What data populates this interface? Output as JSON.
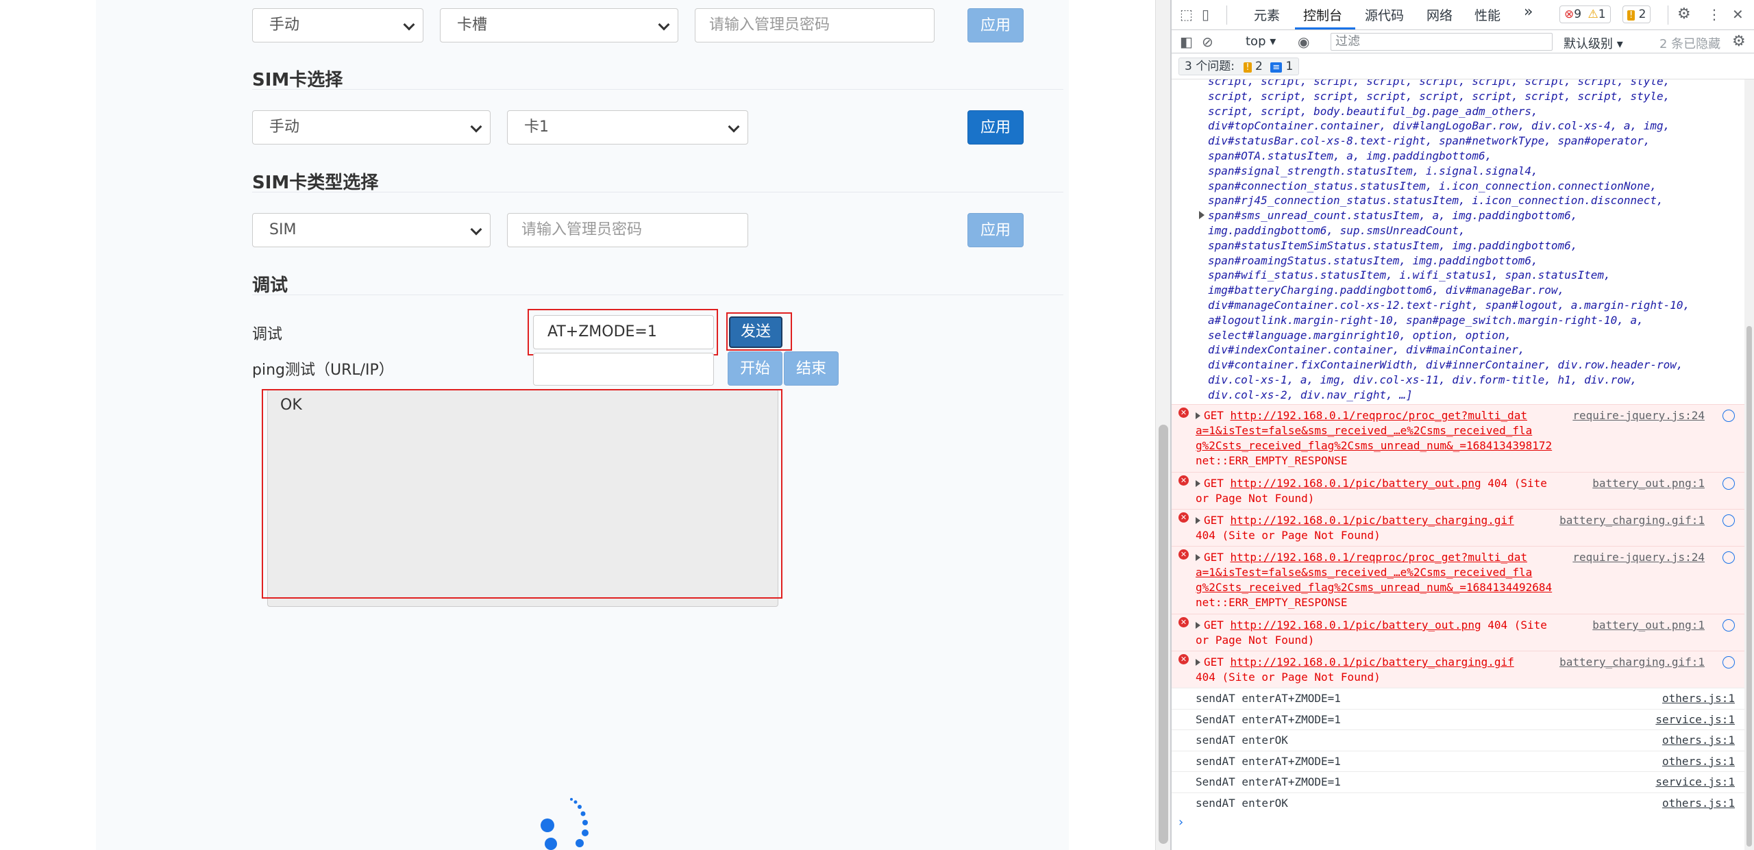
{
  "page": {
    "row0": {
      "mode": "手动",
      "slot": "卡槽",
      "password_placeholder": "请输入管理员密码",
      "apply": "应用"
    },
    "sim_select": {
      "title": "SIM卡选择",
      "mode": "手动",
      "card": "卡1",
      "apply": "应用"
    },
    "sim_type": {
      "title": "SIM卡类型选择",
      "type": "SIM",
      "password_placeholder": "请输入管理员密码",
      "apply": "应用"
    },
    "debug": {
      "title": "调试",
      "at_label": "调试",
      "at_value": "AT+ZMODE=1",
      "send": "发送",
      "ping_label": "ping测试（URL/IP）",
      "start": "开始",
      "stop": "结束",
      "output": "OK"
    }
  },
  "devtools": {
    "tabs": [
      "元素",
      "控制台",
      "源代码",
      "网络",
      "性能"
    ],
    "active_tab": "控制台",
    "more": "»",
    "errors_count": "9",
    "warnings_count": "1",
    "issues_badge": "2",
    "context": "top",
    "filter_placeholder": "过滤",
    "level": "默认级别",
    "hidden": "2 条已隐藏",
    "issues_label": "3 个问题:",
    "issues_warn": "2",
    "issues_info": "1",
    "elements_lines": [
      "script, script, script, script, script, script, script, script, style,",
      "script, script, script, script, script, script, script, script, style,",
      "script, script, body.beautiful_bg.page_adm_others,",
      "div#topContainer.container, div#langLogoBar.row, div.col-xs-4, a, img,",
      "div#statusBar.col-xs-8.text-right, span#networkType, span#operator,",
      "span#OTA.statusItem, a, img.paddingbottom6,",
      "span#signal_strength.statusItem, i.signal.signal4,",
      "span#connection_status.statusItem, i.icon_connection.connectionNone,",
      "span#rj45_connection_status.statusItem, i.icon_connection.disconnect,",
      "span#sms_unread_count.statusItem, a, img.paddingbottom6,",
      "img.paddingbottom6, sup.smsUnreadCount,",
      "span#statusItemSimStatus.statusItem, img.paddingbottom6,",
      "span#roamingStatus.statusItem, img.paddingbottom6,",
      "span#wifi_status.statusItem, i.wifi_status1, span.statusItem,",
      "img#batteryCharging.paddingbottom6, div#manageBar.row,",
      "div#manageContainer.col-xs-12.text-right, span#logout, a.margin-right-10,",
      "a#logoutlink.margin-right-10, span#page_switch.margin-right-10, a,",
      "select#language.marginright10, option, option,",
      "div#indexContainer.container, div#mainContainer,",
      "div#container.fixContainerWidth, div#innerContainer, div.row.header-row,",
      "div.col-xs-1, a, img, div.col-xs-11, div.form-title, h1, div.row,",
      "div.col-xs-2, div.nav_right, …]"
    ],
    "errors": [
      {
        "method": "GET",
        "url": [
          "http://192.168.0.1/reqproc/proc_get?multi_dat",
          "a=1&isTest=false&sms_received_…e%2Csms_received_fla",
          "g%2Csts_received_flag%2Csms_unread_num&_=1684134398172"
        ],
        "tail": "net::ERR_EMPTY_RESPONSE",
        "source": "require-jquery.js:24"
      },
      {
        "method": "GET",
        "url": [
          "http://192.168.0.1/pic/battery_out.png"
        ],
        "status": "404 (Site",
        "tail": "or Page Not Found)",
        "source": "battery_out.png:1"
      },
      {
        "method": "GET",
        "url": [
          "http://192.168.0.1/pic/battery_charging.gif"
        ],
        "tail": "404 (Site or Page Not Found)",
        "source": "battery_charging.gif:1"
      },
      {
        "method": "GET",
        "url": [
          "http://192.168.0.1/reqproc/proc_get?multi_dat",
          "a=1&isTest=false&sms_received_…e%2Csms_received_fla",
          "g%2Csts_received_flag%2Csms_unread_num&_=1684134492684"
        ],
        "tail": "net::ERR_EMPTY_RESPONSE",
        "source": "require-jquery.js:24"
      },
      {
        "method": "GET",
        "url": [
          "http://192.168.0.1/pic/battery_out.png"
        ],
        "status": "404 (Site",
        "tail": "or Page Not Found)",
        "source": "battery_out.png:1"
      },
      {
        "method": "GET",
        "url": [
          "http://192.168.0.1/pic/battery_charging.gif"
        ],
        "tail": "404 (Site or Page Not Found)",
        "source": "battery_charging.gif:1"
      }
    ],
    "logs": [
      {
        "text": "sendAT enterAT+ZMODE=1",
        "source": "others.js:1"
      },
      {
        "text": "SendAT enterAT+ZMODE=1",
        "source": "service.js:1"
      },
      {
        "text": "sendAT enterOK",
        "source": "others.js:1"
      },
      {
        "text": "sendAT enterAT+ZMODE=1",
        "source": "others.js:1"
      },
      {
        "text": "SendAT enterAT+ZMODE=1",
        "source": "service.js:1"
      },
      {
        "text": "sendAT enterOK",
        "source": "others.js:1"
      }
    ],
    "prompt": "›"
  },
  "colors": {
    "accent": "#1a73c9",
    "accent_light": "#84b4e4",
    "highlight": "#e02020",
    "error_bg": "#fff0f0"
  }
}
